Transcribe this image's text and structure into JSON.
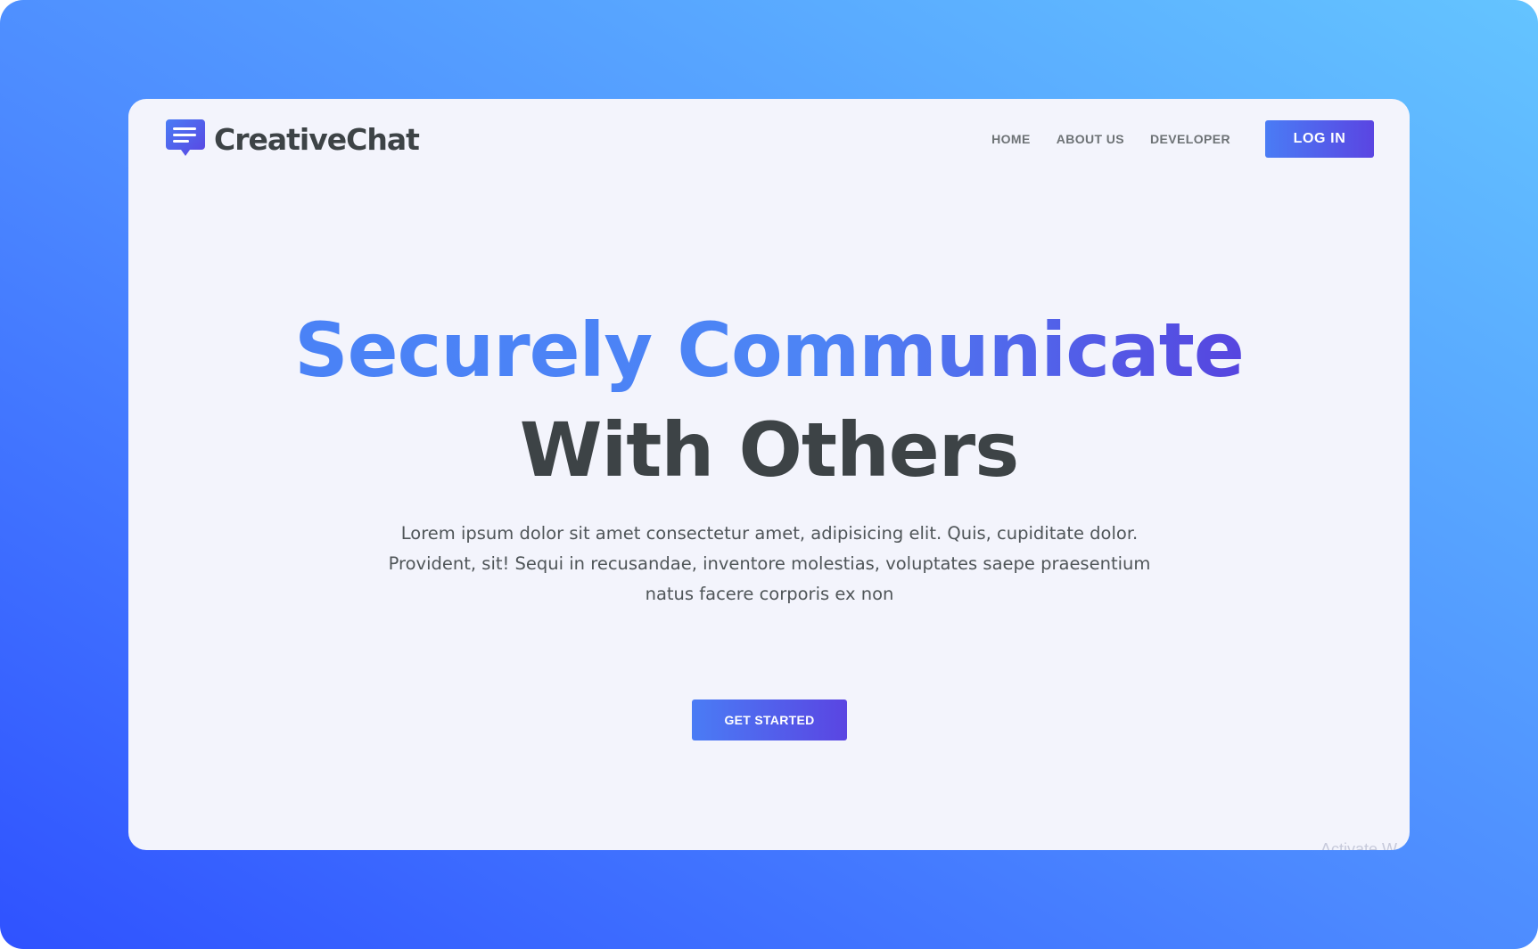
{
  "brand": {
    "name": "CreativeChat",
    "icon": "chat-bubble-icon"
  },
  "nav": {
    "links": [
      "HOME",
      "ABOUT US",
      "DEVELOPER"
    ],
    "login_label": "LOG IN"
  },
  "hero": {
    "title_line_1": "Securely Communicate",
    "title_line_2": "With Others",
    "description_lines": [
      "Lorem ipsum dolor sit amet consectetur amet, adipisicing elit. Quis, cupiditate dolor.",
      "Provident, sit! Sequi in recusandae, inventore molestias, voluptates saepe praesentium",
      "natus facere corporis ex non"
    ],
    "cta_label": "GET STARTED"
  },
  "watermark": {
    "text": "Activate W"
  },
  "colors": {
    "accent_start": "#4a7cf5",
    "accent_end": "#5a45e2",
    "heading_dark": "#3d4346",
    "page_bg": "#f3f4fc",
    "backdrop_start": "#2f52ff",
    "backdrop_end": "#64c4ff"
  }
}
